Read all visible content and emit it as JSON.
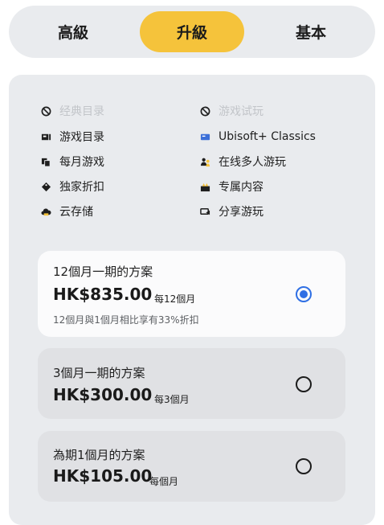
{
  "tabs": [
    {
      "label": "高級",
      "selected": false
    },
    {
      "label": "升級",
      "selected": true
    },
    {
      "label": "基本",
      "selected": false
    }
  ],
  "colors": {
    "accent_tab": "#f5c33b",
    "radio_selected": "#2f6fe4"
  },
  "features": [
    {
      "label": "经典目录",
      "icon": "unavailable-icon",
      "disabled": true
    },
    {
      "label": "游戏试玩",
      "icon": "unavailable-icon",
      "disabled": true
    },
    {
      "label": "游戏目录",
      "icon": "game-catalog-icon",
      "disabled": false
    },
    {
      "label": "Ubisoft+ Classics",
      "icon": "ubisoft-classics-icon",
      "disabled": false
    },
    {
      "label": "每月游戏",
      "icon": "monthly-games-icon",
      "disabled": false
    },
    {
      "label": "在线多人游玩",
      "icon": "online-multiplayer-icon",
      "disabled": false
    },
    {
      "label": "独家折扣",
      "icon": "discount-tag-icon",
      "disabled": false
    },
    {
      "label": "专属内容",
      "icon": "exclusive-content-icon",
      "disabled": false
    },
    {
      "label": "云存储",
      "icon": "cloud-storage-icon",
      "disabled": false
    },
    {
      "label": "分享游玩",
      "icon": "share-play-icon",
      "disabled": false
    }
  ],
  "plans": [
    {
      "title": "12個月一期的方案",
      "price": "HK$835.00",
      "per": "每12個月",
      "note": "12個月與1個月相比享有33%折扣",
      "selected": true
    },
    {
      "title": "3個月一期的方案",
      "price": "HK$300.00",
      "per": "每3個月",
      "selected": false
    },
    {
      "title": "為期1個月的方案",
      "price": "HK$105.00",
      "per": "每個月",
      "selected": false
    }
  ]
}
